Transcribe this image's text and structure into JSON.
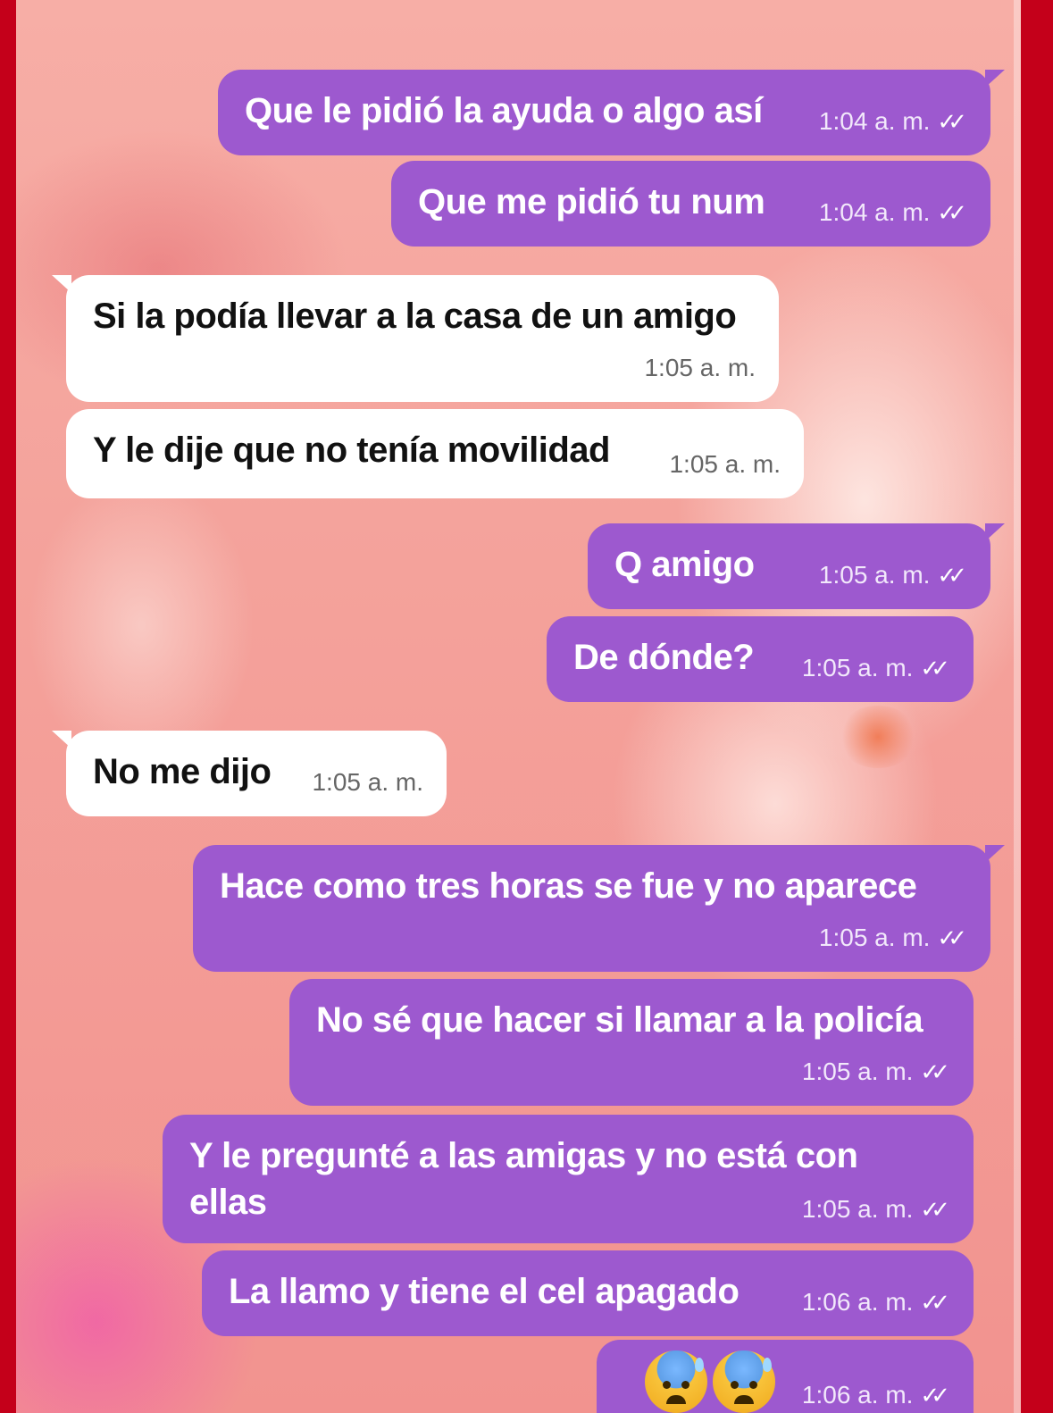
{
  "messages": [
    {
      "direction": "out",
      "text": "Que le pidió la ayuda o algo así",
      "time": "1:04 a. m.",
      "ticks": "✓✓"
    },
    {
      "direction": "out",
      "text": "Que me pidió tu num",
      "time": "1:04 a. m.",
      "ticks": "✓✓"
    },
    {
      "direction": "in",
      "text": "Si la podía llevar a la casa de un amigo",
      "time": "1:05 a. m."
    },
    {
      "direction": "in",
      "text": "Y le dije que no tenía movilidad",
      "time": "1:05 a. m."
    },
    {
      "direction": "out",
      "text": "Q amigo",
      "time": "1:05 a. m.",
      "ticks": "✓✓"
    },
    {
      "direction": "out",
      "text": "De dónde?",
      "time": "1:05 a. m.",
      "ticks": "✓✓"
    },
    {
      "direction": "in",
      "text": "No me dijo",
      "time": "1:05 a. m."
    },
    {
      "direction": "out",
      "text": "Hace como tres horas se fue y no aparece",
      "time": "1:05 a. m.",
      "ticks": "✓✓"
    },
    {
      "direction": "out",
      "text": "No sé que hacer si llamar a la policía",
      "time": "1:05 a. m.",
      "ticks": "✓✓"
    },
    {
      "direction": "out",
      "text": "Y le pregunté a las amigas y no está con ellas",
      "time": "1:05 a. m.",
      "ticks": "✓✓"
    },
    {
      "direction": "out",
      "text": "La llamo y tiene el cel apagado",
      "time": "1:06 a. m.",
      "ticks": "✓✓"
    },
    {
      "direction": "out",
      "emoji": [
        "anxious-face-with-sweat",
        "anxious-face-with-sweat"
      ],
      "time": "1:06 a. m.",
      "ticks": "✓✓"
    }
  ],
  "colors": {
    "outgoing_bubble": "#9d59cf",
    "incoming_bubble": "#ffffff",
    "frame": "#c4001a",
    "wallpaper": "#f4a29b"
  }
}
